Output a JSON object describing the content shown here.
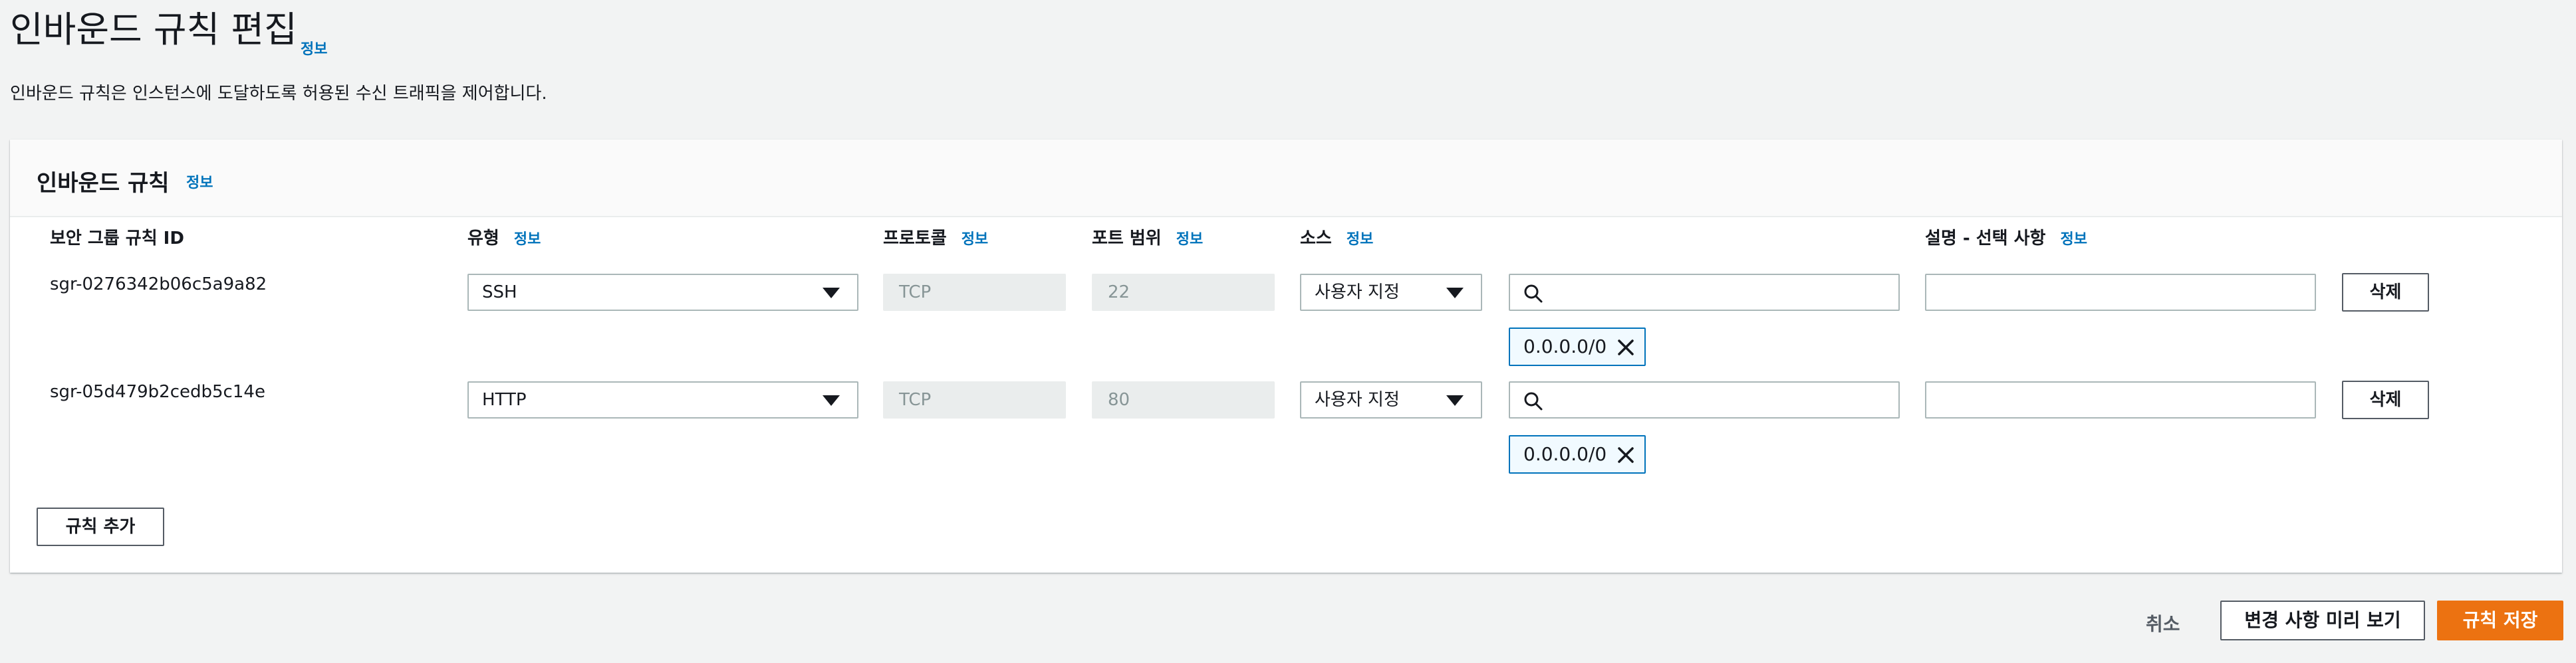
{
  "header": {
    "title": "인바운드 규칙 편집",
    "info_label": "정보",
    "description": "인바운드 규칙은 인스턴스에 도달하도록 허용된 수신 트래픽을 제어합니다."
  },
  "panel": {
    "title": "인바운드 규칙",
    "info_label": "정보",
    "columns": {
      "rule_id": "보안 그룹 규칙 ID",
      "type": "유형",
      "protocol": "프로토콜",
      "port_range": "포트 범위",
      "source": "소스",
      "description": "설명 - 선택 사항",
      "info_label": "정보"
    },
    "rules": [
      {
        "id": "sgr-0276342b06c5a9a82",
        "type": "SSH",
        "protocol": "TCP",
        "port": "22",
        "source_mode": "사용자 지정",
        "search_value": "",
        "cidr_token": "0.0.0.0/0",
        "description_value": "",
        "delete_label": "삭제"
      },
      {
        "id": "sgr-05d479b2cedb5c14e",
        "type": "HTTP",
        "protocol": "TCP",
        "port": "80",
        "source_mode": "사용자 지정",
        "search_value": "",
        "cidr_token": "0.0.0.0/0",
        "description_value": "",
        "delete_label": "삭제"
      }
    ],
    "add_rule_label": "규칙 추가"
  },
  "footer": {
    "cancel_label": "취소",
    "preview_label": "변경 사항 미리 보기",
    "save_label": "규칙 저장"
  },
  "colors": {
    "accent_link": "#0073bb",
    "primary_button": "#ec7211",
    "token_bg": "#f1faff",
    "page_bg": "#f2f3f3"
  },
  "icons": {
    "dropdown": "caret-down-icon",
    "search": "search-icon",
    "token_remove": "close-icon"
  }
}
